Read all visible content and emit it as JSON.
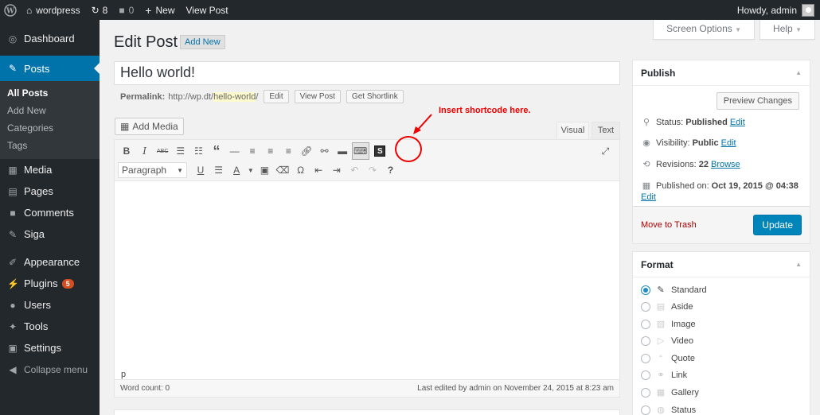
{
  "adminbar": {
    "site_name": "wordpress",
    "updates_count": "8",
    "comments_count": "0",
    "new_label": "New",
    "view_post_label": "View Post",
    "howdy": "Howdy, admin"
  },
  "sidebar": {
    "dashboard": "Dashboard",
    "posts": "Posts",
    "posts_sub": [
      "All Posts",
      "Add New",
      "Categories",
      "Tags"
    ],
    "media": "Media",
    "pages": "Pages",
    "comments": "Comments",
    "siga": "Siga",
    "appearance": "Appearance",
    "plugins": "Plugins",
    "plugins_badge": "5",
    "users": "Users",
    "tools": "Tools",
    "settings": "Settings",
    "collapse": "Collapse menu"
  },
  "header": {
    "screen_options": "Screen Options",
    "help": "Help",
    "title": "Edit Post",
    "add_new": "Add New"
  },
  "post": {
    "title": "Hello world!",
    "permalink_label": "Permalink:",
    "permalink_base": "http://wp.dt/",
    "permalink_slug": "hello-world",
    "permalink_trailing": "/",
    "edit_btn": "Edit",
    "view_post_btn": "View Post",
    "shortlink_btn": "Get Shortlink"
  },
  "editor": {
    "add_media": "Add Media",
    "tab_visual": "Visual",
    "tab_text": "Text",
    "format_select": "Paragraph",
    "shortcode_glyph": "S",
    "path": "p",
    "word_count": "Word count: 0",
    "last_edited": "Last edited by admin on November 24, 2015 at 8:23 am"
  },
  "annotation": {
    "text": "Insert shortcode here.",
    "color": "#e00000"
  },
  "publish": {
    "title": "Publish",
    "preview": "Preview Changes",
    "status_label": "Status:",
    "status_value": "Published",
    "visibility_label": "Visibility:",
    "visibility_value": "Public",
    "revisions_label": "Revisions:",
    "revisions_value": "22",
    "browse": "Browse",
    "published_label": "Published on:",
    "published_value": "Oct 19, 2015 @ 04:38",
    "edit": "Edit",
    "trash": "Move to Trash",
    "update": "Update"
  },
  "format": {
    "title": "Format",
    "options": [
      "Standard",
      "Aside",
      "Image",
      "Video",
      "Quote",
      "Link",
      "Gallery",
      "Status"
    ],
    "selected": "Standard"
  },
  "colors": {
    "adminbar_bg": "#23282d",
    "accent": "#0073aa",
    "update_button": "#0085ba",
    "trash": "#aa0000"
  }
}
